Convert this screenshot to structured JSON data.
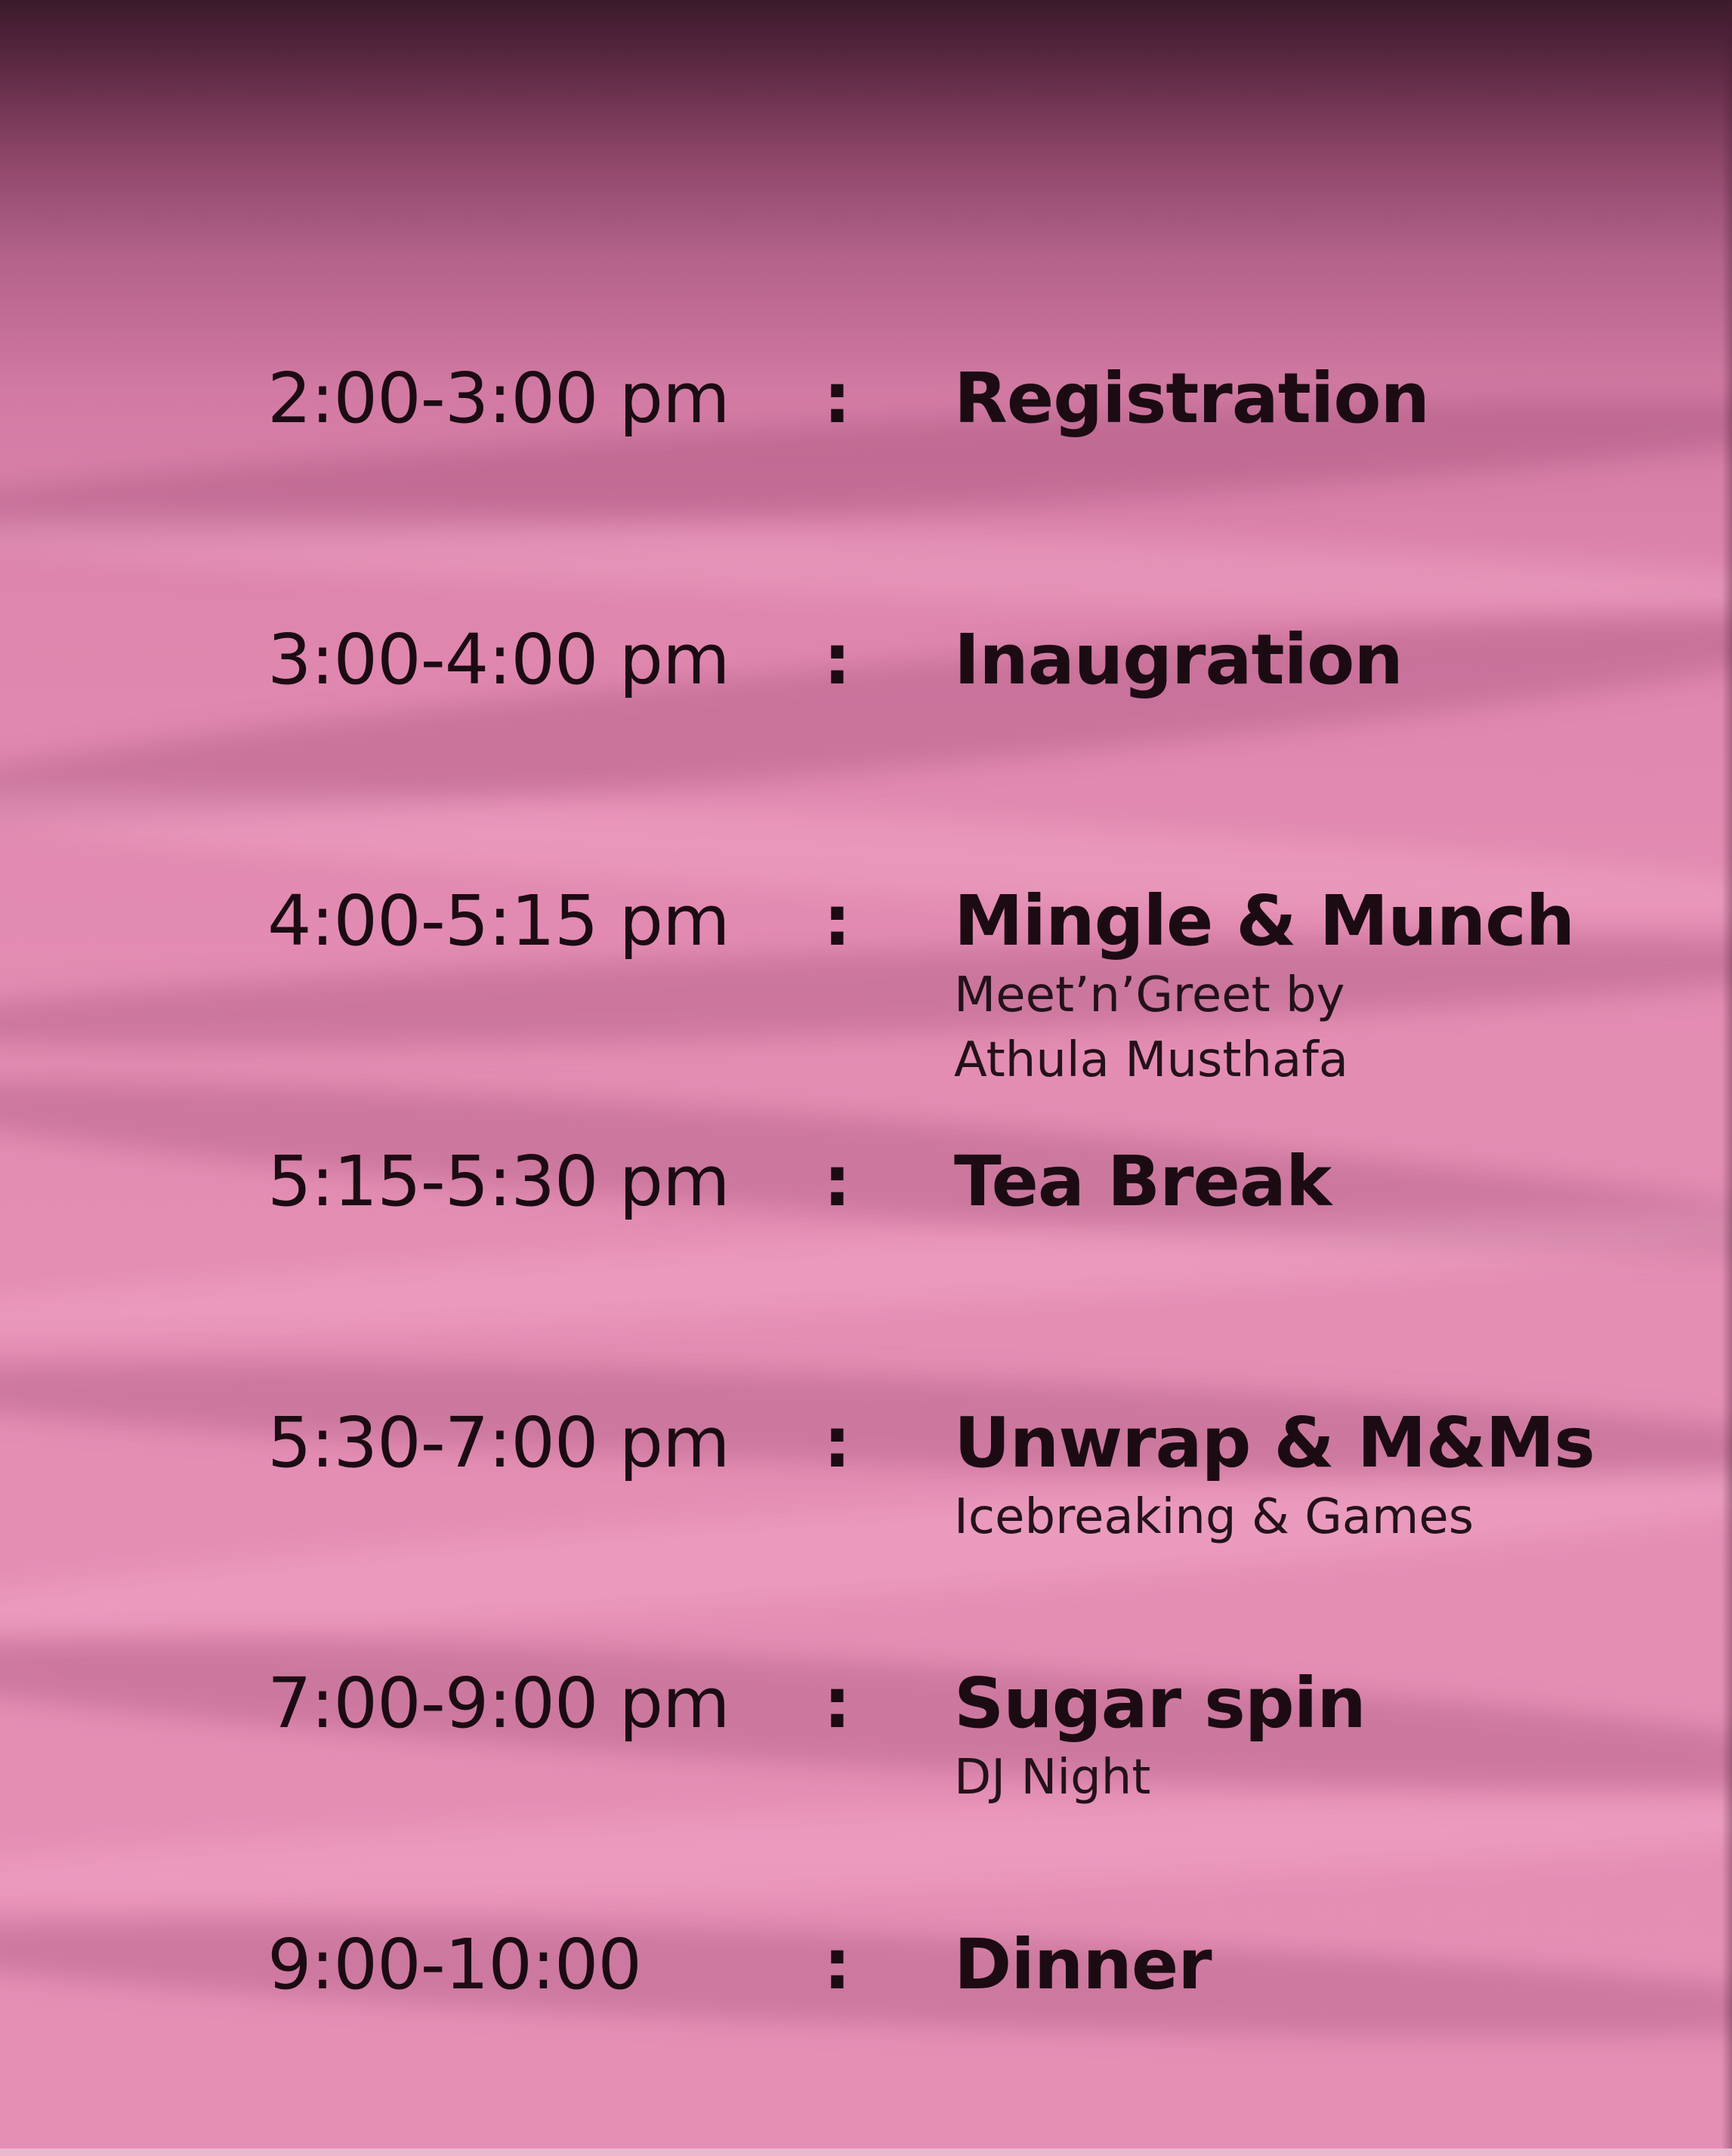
{
  "schedule": [
    {
      "time": "2:00-3:00 pm",
      "separator": ":",
      "title": "Registration",
      "subtitle": []
    },
    {
      "time": "3:00-4:00 pm",
      "separator": ":",
      "title": "Inaugration",
      "subtitle": []
    },
    {
      "time": "4:00-5:15 pm",
      "separator": ":",
      "title": "Mingle & Munch",
      "subtitle": [
        "Meet’n’Greet by",
        "Athula Musthafa"
      ]
    },
    {
      "time": "5:15-5:30 pm",
      "separator": ":",
      "title": "Tea Break",
      "subtitle": []
    },
    {
      "time": "5:30-7:00 pm",
      "separator": ":",
      "title": "Unwrap & M&Ms",
      "subtitle": [
        "Icebreaking & Games"
      ]
    },
    {
      "time": "7:00-9:00 pm",
      "separator": ":",
      "title": "Sugar spin",
      "subtitle": [
        "DJ Night"
      ]
    },
    {
      "time": "9:00-10:00",
      "separator": ":",
      "title": "Dinner",
      "subtitle": []
    }
  ],
  "colors": {
    "paper": "#e58fb5",
    "top_shadow": "#3a1a2a",
    "text": "#1c0b13"
  }
}
